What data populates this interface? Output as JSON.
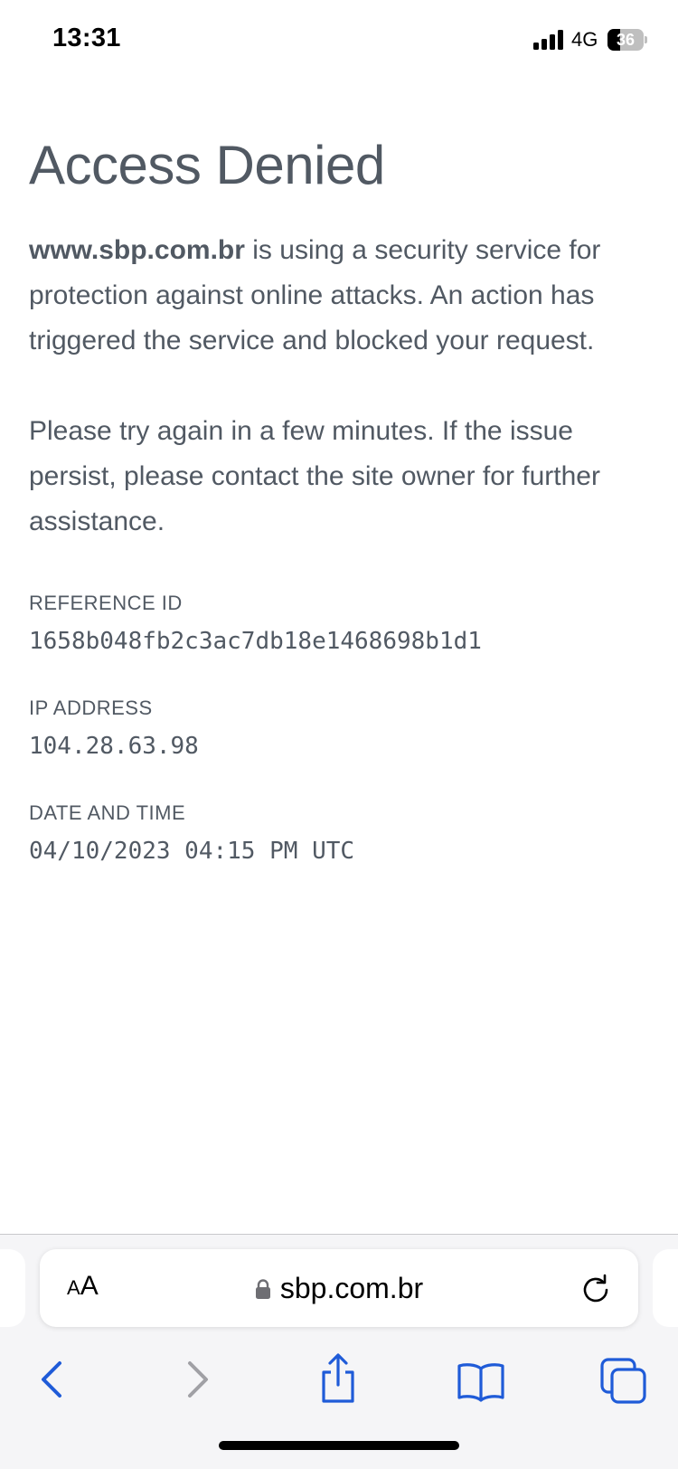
{
  "status_bar": {
    "time": "13:31",
    "network": "4G",
    "battery": "36",
    "battery_level": 0.36
  },
  "page": {
    "title": "Access Denied",
    "intro_domain": "www.sbp.com.br",
    "intro_text": " is using a security service for protection against online attacks. An action has triggered the service and blocked your request.",
    "retry_text": "Please try again in a few minutes. If the issue persist, please contact the site owner for further assistance.",
    "reference_label": "REFERENCE ID",
    "reference_value": "1658b048fb2c3ac7db18e1468698b1d1",
    "ip_label": "IP ADDRESS",
    "ip_value": "104.28.63.98",
    "datetime_label": "DATE AND TIME",
    "datetime_value": "04/10/2023 04:15 PM UTC"
  },
  "browser": {
    "text_size_label_small": "A",
    "text_size_label_large": "A",
    "url": "sbp.com.br",
    "icons": [
      "lock-icon",
      "reload-icon",
      "back-icon",
      "forward-icon",
      "share-icon",
      "bookmarks-icon",
      "tabs-icon"
    ],
    "accent_color": "#1f5bd8",
    "disabled_color": "#a0a0a5"
  }
}
